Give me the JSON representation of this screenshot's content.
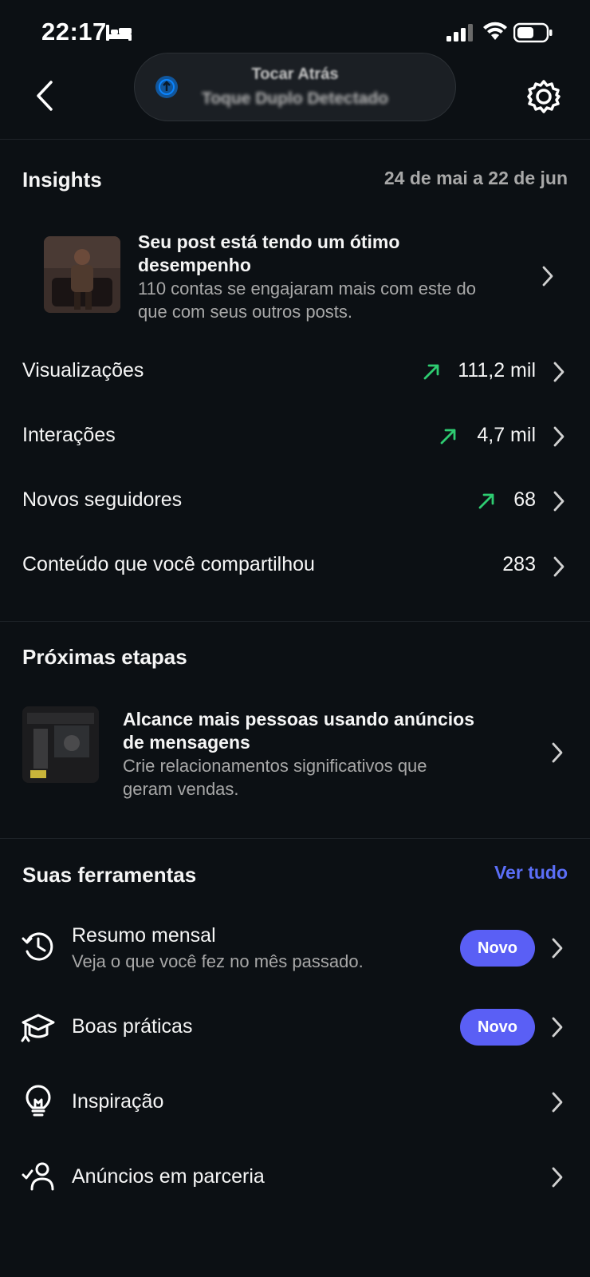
{
  "status_bar": {
    "time": "22:17"
  },
  "header": {
    "notification_title": "Tocar Atrás",
    "notification_subtitle": "Toque Duplo Detectado"
  },
  "insights": {
    "title": "Insights",
    "date_range": "24 de mai a 22 de jun",
    "highlight": {
      "title_line1": "Seu post está tendo um ótimo",
      "title_line2": "desempenho",
      "sub_line1": "110 contas se engajaram mais com este do",
      "sub_line2": "que com seus outros posts."
    },
    "metrics": [
      {
        "label": "Visualizações",
        "value": "111,2 mil",
        "trend": "up"
      },
      {
        "label": "Interações",
        "value": "4,7 mil",
        "trend": "up"
      },
      {
        "label": "Novos seguidores",
        "value": "68",
        "trend": "up"
      },
      {
        "label": "Conteúdo que você compartilhou",
        "value": "283",
        "trend": ""
      }
    ]
  },
  "next_steps": {
    "title": "Próximas etapas",
    "card": {
      "title_line1": "Alcance mais pessoas usando anúncios",
      "title_line2": "de mensagens",
      "sub_line1": "Crie relacionamentos significativos que",
      "sub_line2": "geram vendas."
    }
  },
  "tools": {
    "title": "Suas ferramentas",
    "see_all": "Ver tudo",
    "items": [
      {
        "label": "Resumo mensal",
        "sub": "Veja o que você fez no mês passado.",
        "badge": "Novo",
        "icon": "history-icon"
      },
      {
        "label": "Boas práticas",
        "badge": "Novo",
        "icon": "graduation-cap-icon"
      },
      {
        "label": "Inspiração",
        "icon": "lightbulb-icon"
      },
      {
        "label": "Anúncios em parceria",
        "icon": "partner-check-icon"
      }
    ]
  },
  "colors": {
    "background": "#0c1014",
    "trend_green": "#2ecc71",
    "link_blue": "#5b6ef7",
    "badge": "#5a5ff5"
  }
}
